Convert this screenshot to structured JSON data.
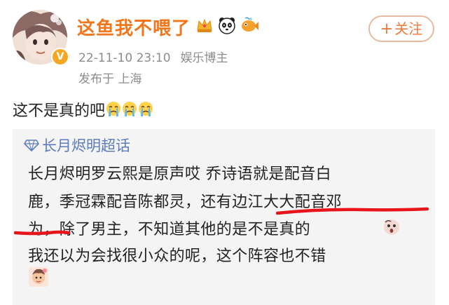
{
  "header": {
    "username": "这鱼我不喂了",
    "badge_icons": [
      "crown-icon",
      "panda-icon",
      "fish-icon"
    ],
    "follow_label": "关注",
    "follow_icon": "plus-icon",
    "timestamp": "22-11-10 23:10",
    "category": "娱乐博主",
    "location": "发布于 上海",
    "verified_icon": "verified-v-icon",
    "accent_color": "#f2761b"
  },
  "post": {
    "text": "这不是真的吧",
    "emojis": [
      "crying-face-icon",
      "crying-face-icon",
      "crying-face-icon"
    ]
  },
  "quote": {
    "topic_icon": "diamond-icon",
    "topic": "长月烬明超话",
    "lines": [
      "长月烬明罗云熙是原声哎 乔诗语就是配音白",
      "鹿，季冠霖配音陈都灵，还有边江大大配音邓",
      "为，除了男主，不知道其他的是不是真的",
      "我还以为会找很小众的呢，这个阵容也不错"
    ],
    "trailing_emoji": "surprised-face-icon",
    "sticker_icon": "sticker-icon",
    "annotation_color": "#e8141b",
    "link_color": "#5b7cbf"
  }
}
